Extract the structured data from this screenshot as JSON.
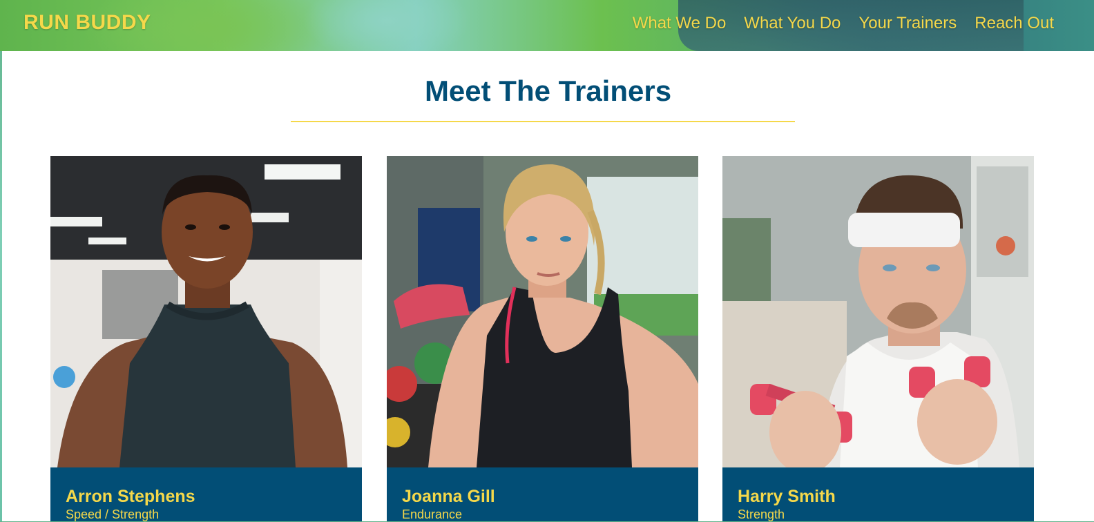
{
  "header": {
    "logo": "RUN BUDDY",
    "nav": [
      "What We Do",
      "What You Do",
      "Your Trainers",
      "Reach Out"
    ]
  },
  "section": {
    "title": "Meet The Trainers"
  },
  "trainers": [
    {
      "name": "Arron Stephens",
      "role": "Speed / Strength"
    },
    {
      "name": "Joanna Gill",
      "role": "Endurance"
    },
    {
      "name": "Harry Smith",
      "role": "Strength"
    }
  ],
  "colors": {
    "primary_blue": "#024e76",
    "accent_yellow": "#f5d84a",
    "background": "#ffffff"
  }
}
